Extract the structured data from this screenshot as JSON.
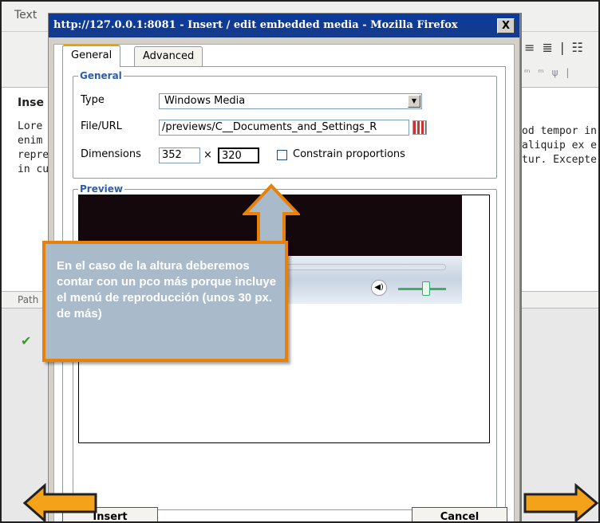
{
  "background_editor": {
    "tab_label": "Text",
    "heading_partial": "Inse",
    "left_lines": [
      "Lore",
      "enim",
      "repre",
      "in cu"
    ],
    "right_lines": [
      "od tempor in",
      "aliquip ex e",
      "tur. Excepte"
    ],
    "path_label": "Path"
  },
  "dialog": {
    "title": "http://127.0.0.1:8081 - Insert / edit embedded media - Mozilla Firefox",
    "close_label": "X",
    "tabs": [
      {
        "label": "General",
        "active": true
      },
      {
        "label": "Advanced",
        "active": false
      }
    ],
    "general": {
      "legend": "General",
      "type_label": "Type",
      "type_value": "Windows Media",
      "url_label": "File/URL",
      "url_value": "/previews/C__Documents_and_Settings_R",
      "dimensions_label": "Dimensions",
      "width": "352",
      "times": "×",
      "height": "320",
      "constrain_label": "Constrain proportions"
    },
    "preview": {
      "legend": "Preview"
    },
    "buttons": {
      "insert": "Insert",
      "cancel": "Cancel"
    }
  },
  "callout": {
    "text": "En el caso de la altura deberemos contar con un pco más porque incluye el menú de reproducción (unos 30 px. de más)"
  },
  "colors": {
    "accent": "#e8810a",
    "callout_bg": "#a9bacb",
    "titlebar": "#0b3b9e"
  }
}
